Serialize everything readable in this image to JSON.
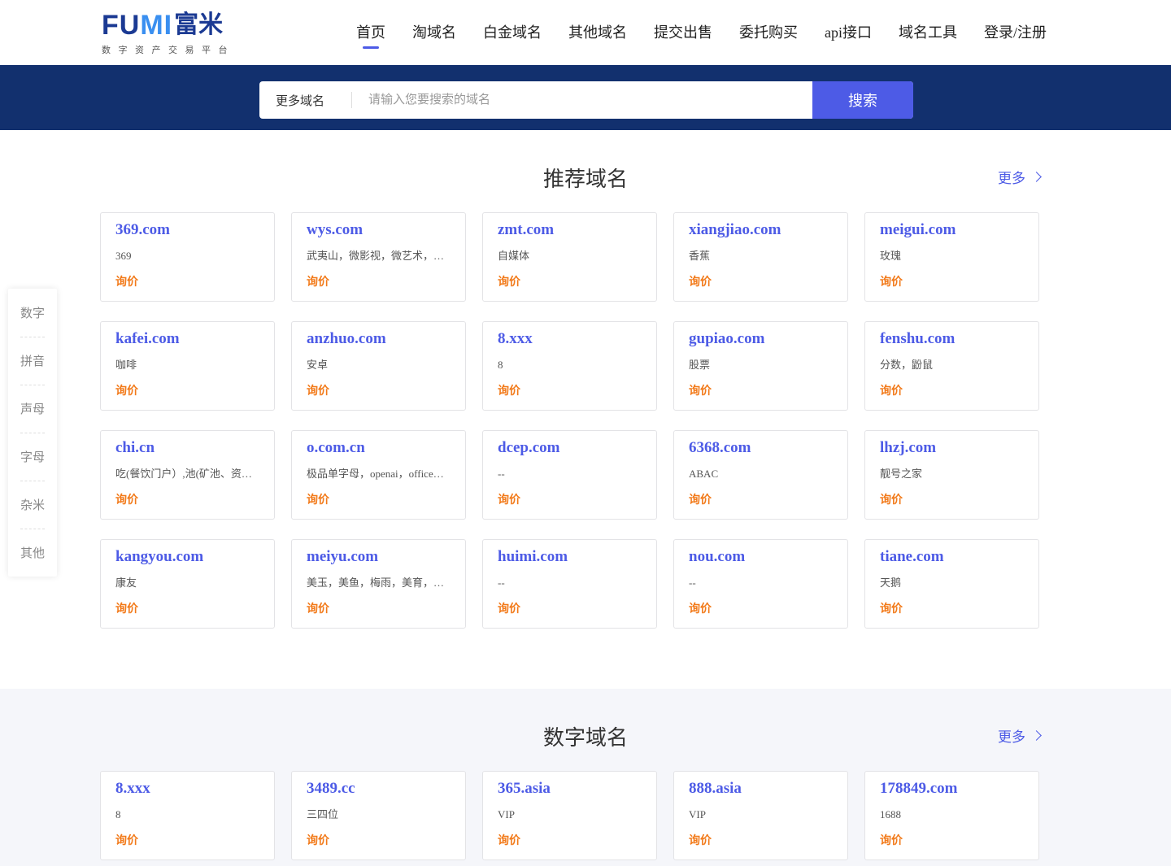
{
  "logo": {
    "latin_prefix": "FU",
    "latin_mi": "MI",
    "cn": "富米",
    "subtitle": "数字资产交易平台"
  },
  "nav": [
    {
      "label": "首页",
      "active": true
    },
    {
      "label": "淘域名"
    },
    {
      "label": "白金域名"
    },
    {
      "label": "其他域名"
    },
    {
      "label": "提交出售"
    },
    {
      "label": "委托购买"
    },
    {
      "label": "api接口"
    },
    {
      "label": "域名工具"
    },
    {
      "label": "登录/注册"
    }
  ],
  "search": {
    "select_label": "更多域名",
    "placeholder": "请输入您要搜索的域名",
    "value": "",
    "button_label": "搜索"
  },
  "side_menu": [
    "数字",
    "拼音",
    "声母",
    "字母",
    "杂米",
    "其他"
  ],
  "colors": {
    "brand_navy": "#12306e",
    "accent": "#4d5be6",
    "price": "#f27a1a"
  },
  "recommended": {
    "title": "推荐域名",
    "more": "更多",
    "cards": [
      {
        "name": "369.com",
        "desc": "369",
        "price": "询价"
      },
      {
        "name": "wys.com",
        "desc": "武夷山，微影视，微艺术，…",
        "price": "询价"
      },
      {
        "name": "zmt.com",
        "desc": "自媒体",
        "price": "询价"
      },
      {
        "name": "xiangjiao.com",
        "desc": "香蕉",
        "price": "询价"
      },
      {
        "name": "meigui.com",
        "desc": "玫瑰",
        "price": "询价"
      },
      {
        "name": "kafei.com",
        "desc": "咖啡",
        "price": "询价"
      },
      {
        "name": "anzhuo.com",
        "desc": "安卓",
        "price": "询价"
      },
      {
        "name": "8.xxx",
        "desc": "8",
        "price": "询价"
      },
      {
        "name": "gupiao.com",
        "desc": "股票",
        "price": "询价"
      },
      {
        "name": "fenshu.com",
        "desc": "分数，鼢鼠",
        "price": "询价"
      },
      {
        "name": "chi.cn",
        "desc": "吃(餐饮门户）,池(矿池、资…",
        "price": "询价"
      },
      {
        "name": "o.com.cn",
        "desc": "极品单字母，openai，office…",
        "price": "询价"
      },
      {
        "name": "dcep.com",
        "desc": "--",
        "price": "询价"
      },
      {
        "name": "6368.com",
        "desc": "ABAC",
        "price": "询价"
      },
      {
        "name": "lhzj.com",
        "desc": "靓号之家",
        "price": "询价"
      },
      {
        "name": "kangyou.com",
        "desc": "康友",
        "price": "询价"
      },
      {
        "name": "meiyu.com",
        "desc": "美玉，美鱼，梅雨，美育，…",
        "price": "询价"
      },
      {
        "name": "huimi.com",
        "desc": "--",
        "price": "询价"
      },
      {
        "name": "nou.com",
        "desc": "--",
        "price": "询价"
      },
      {
        "name": "tiane.com",
        "desc": "天鹅",
        "price": "询价"
      }
    ]
  },
  "digital": {
    "title": "数字域名",
    "more": "更多",
    "cards": [
      {
        "name": "8.xxx",
        "desc": "8",
        "price": "询价"
      },
      {
        "name": "3489.cc",
        "desc": "三四位",
        "price": "询价"
      },
      {
        "name": "365.asia",
        "desc": "VIP",
        "price": "询价"
      },
      {
        "name": "888.asia",
        "desc": "VIP",
        "price": "询价"
      },
      {
        "name": "178849.com",
        "desc": "1688",
        "price": "询价"
      }
    ]
  }
}
